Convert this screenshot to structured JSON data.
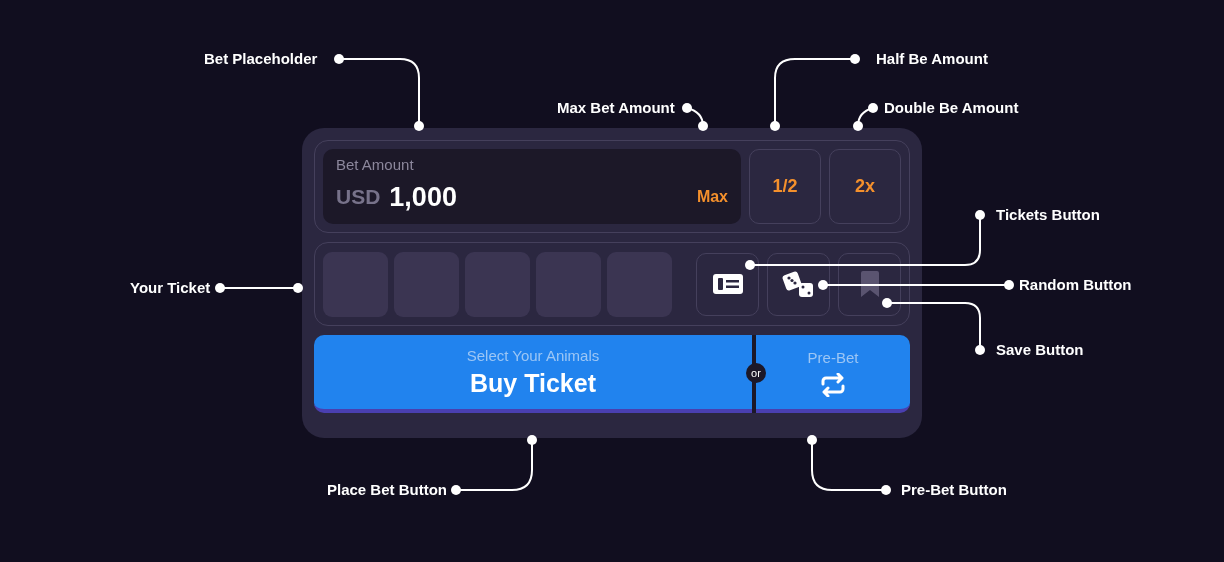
{
  "bet": {
    "label": "Bet Amount",
    "currency": "USD",
    "amount": "1,000",
    "max": "Max"
  },
  "quick_buttons": [
    {
      "label": "1/2"
    },
    {
      "label": "2x"
    }
  ],
  "ticket_slots": [
    {
      "kind": "empty"
    },
    {
      "kind": "empty"
    },
    {
      "kind": "empty"
    },
    {
      "kind": "empty"
    },
    {
      "kind": "empty"
    }
  ],
  "tools": [
    {
      "kind": "tickets",
      "disabled": false
    },
    {
      "kind": "random",
      "disabled": false
    },
    {
      "kind": "save",
      "disabled": true
    }
  ],
  "buy": {
    "hint": "Select Your Animals",
    "label": "Buy Ticket"
  },
  "separator": "or",
  "pre_bet": {
    "hint": "Pre-Bet"
  },
  "annotations": [
    {
      "label": "Bet Placeholder"
    },
    {
      "label": "Max Bet Amount"
    },
    {
      "label": "Half Be Amount"
    },
    {
      "label": "Double Be Amount"
    },
    {
      "label": "Tickets Button"
    },
    {
      "label": "Random Button"
    },
    {
      "label": "Save Button"
    },
    {
      "label": "Your Ticket"
    },
    {
      "label": "Place Bet Button"
    },
    {
      "label": "Pre-Bet Button"
    }
  ]
}
